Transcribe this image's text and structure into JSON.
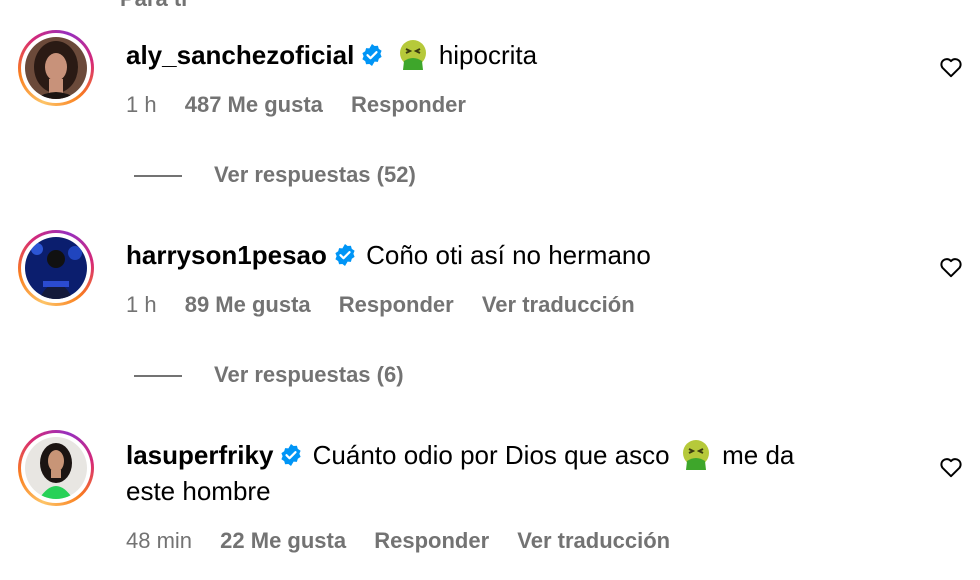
{
  "top_partial_text": "Para ti",
  "comments": [
    {
      "username": "aly_sanchezoficial",
      "text_before_emoji": "",
      "text": "hipocrita",
      "time": "1 h",
      "likes": "487 Me gusta",
      "reply": "Responder",
      "translate": "",
      "replies": "Ver respuestas (52)",
      "avatar_icon": "woman-portrait"
    },
    {
      "username": "harryson1pesao",
      "text": "Coño oti así no hermano",
      "time": "1 h",
      "likes": "89 Me gusta",
      "reply": "Responder",
      "translate": "Ver traducción",
      "replies": "Ver respuestas (6)",
      "avatar_icon": "man-blue-stage"
    },
    {
      "username": "lasuperfriky",
      "text": "Cuánto odio por Dios que asco",
      "text_after_emoji": "me da",
      "text_line2": "este hombre",
      "time": "48 min",
      "likes": "22 Me gusta",
      "reply": "Responder",
      "translate": "Ver traducción",
      "avatar_icon": "woman-green-top"
    }
  ],
  "colors": {
    "secondary_text": "#737373",
    "verified_blue": "#0095f6"
  }
}
